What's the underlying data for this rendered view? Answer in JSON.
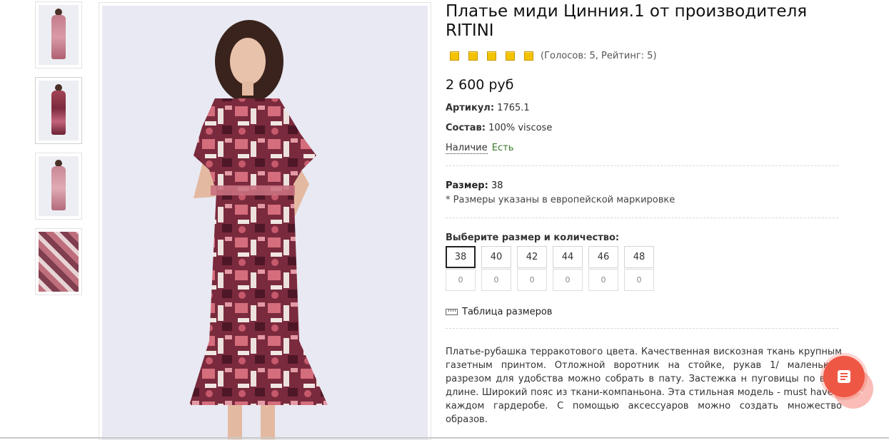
{
  "product": {
    "title": "Платье миди Цинния.1 от производителя RITINI",
    "rating_text": "(Голосов: 5, Рейтинг: 5)",
    "stars": 5,
    "price": "2 600 руб",
    "article_label": "Артикул:",
    "article_value": "1765.1",
    "composition_label": "Состав:",
    "composition_value": "100% viscose",
    "availability_label": "Наличие",
    "availability_value": "Есть",
    "size_label": "Размер:",
    "size_value": "38",
    "size_note": "* Размеры указаны в европейской маркировке",
    "choose_label": "Выберите размер и количество:",
    "sizes": [
      "38",
      "40",
      "42",
      "44",
      "46",
      "48"
    ],
    "quantities": [
      "0",
      "0",
      "0",
      "0",
      "0",
      "0"
    ],
    "selected_size": "38",
    "size_table_label": "Таблица размеров",
    "description": "Платье-рубашка терракотового цвета. Качественная вискозная ткань крупным газетным принтом. Отложной воротник на стойке, рукав 1/ маленьким разрезом для удобства можно собрать в пату. Застежка н пуговицы по всей длине. Широкий пояс из ткани-компаньона. Эта стильная модель - must have в каждом гардеробе. С помощью аксессуаров можно создать множество образов."
  },
  "colors": {
    "accent": "#ef5745",
    "star": "#f3c300",
    "in_stock": "#3a7a2e",
    "dress_primary": "#7d2a3e",
    "dress_secondary": "#c3647a"
  },
  "icons": {
    "fab": "document-lines-icon",
    "scroll_top": "chevron-up-icon",
    "size_table": "ruler-icon",
    "star": "star-icon"
  }
}
